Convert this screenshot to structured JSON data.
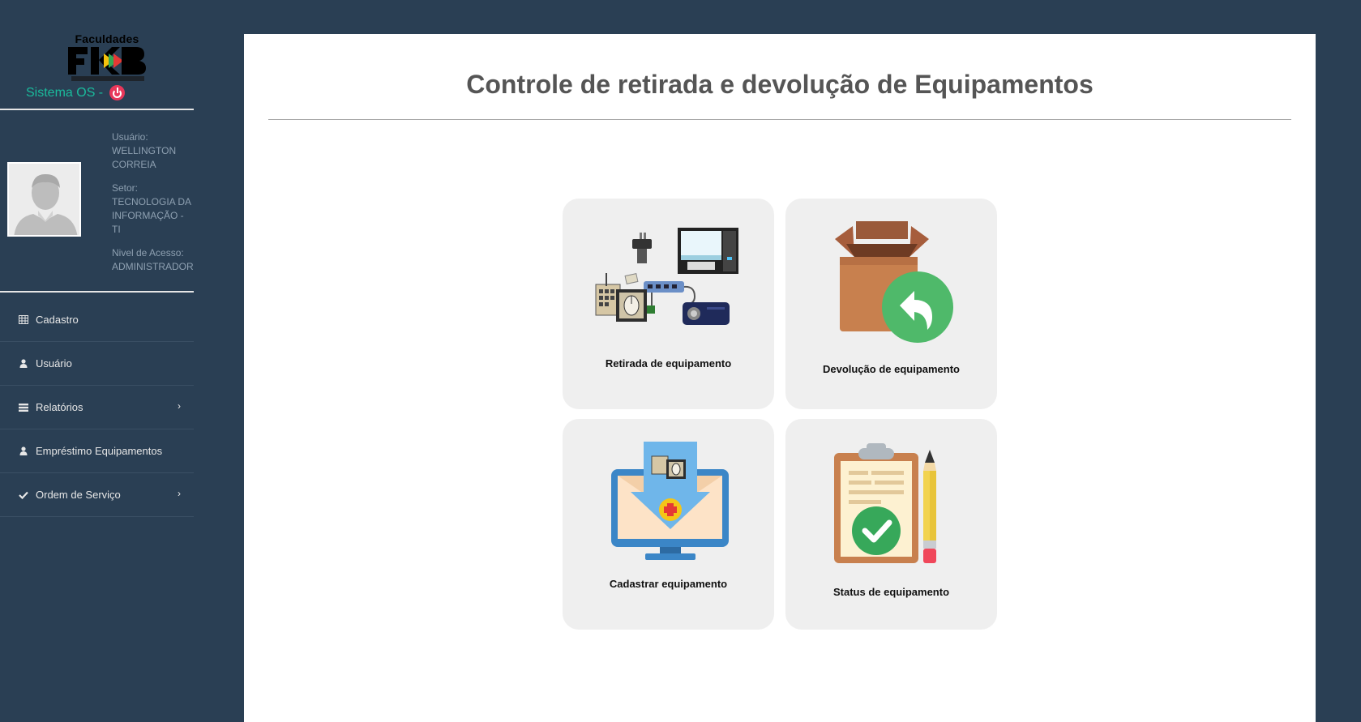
{
  "sidebar": {
    "logo": {
      "top_text": "Faculdades",
      "brand": "FKB"
    },
    "system_title": "Sistema OS -",
    "user": {
      "user_label": "Usuário:",
      "user_value": "WELLINGTON CORREIA",
      "sector_label": "Setor:",
      "sector_value": "TECNOLOGIA DA INFORMAÇÃO - TI",
      "access_label": "Nivel de Acesso:",
      "access_value": "ADMINISTRADOR"
    },
    "menu": [
      {
        "label": "Cadastro",
        "icon": "table-icon"
      },
      {
        "label": "Usuário",
        "icon": "user-icon"
      },
      {
        "label": "Relatórios",
        "icon": "list-icon",
        "chevron": "›"
      },
      {
        "label": "Empréstimo Equipamentos",
        "icon": "user-icon"
      },
      {
        "label": "Ordem de Serviço",
        "icon": "check-icon",
        "chevron": "›"
      }
    ]
  },
  "main": {
    "title": "Controle de retirada e devolução de Equipamentos",
    "cards": [
      {
        "label": "Retirada de equipamento",
        "icon": "equipment-collection-icon"
      },
      {
        "label": "Devolução de equipamento",
        "icon": "box-return-icon"
      },
      {
        "label": "Cadastrar equipamento",
        "icon": "monitor-add-icon"
      },
      {
        "label": "Status de equipamento",
        "icon": "clipboard-check-icon"
      }
    ]
  },
  "colors": {
    "sidebar_bg": "#2a3f54",
    "accent": "#1abb9c",
    "power": "#e8375a",
    "card_bg": "#efefef"
  }
}
